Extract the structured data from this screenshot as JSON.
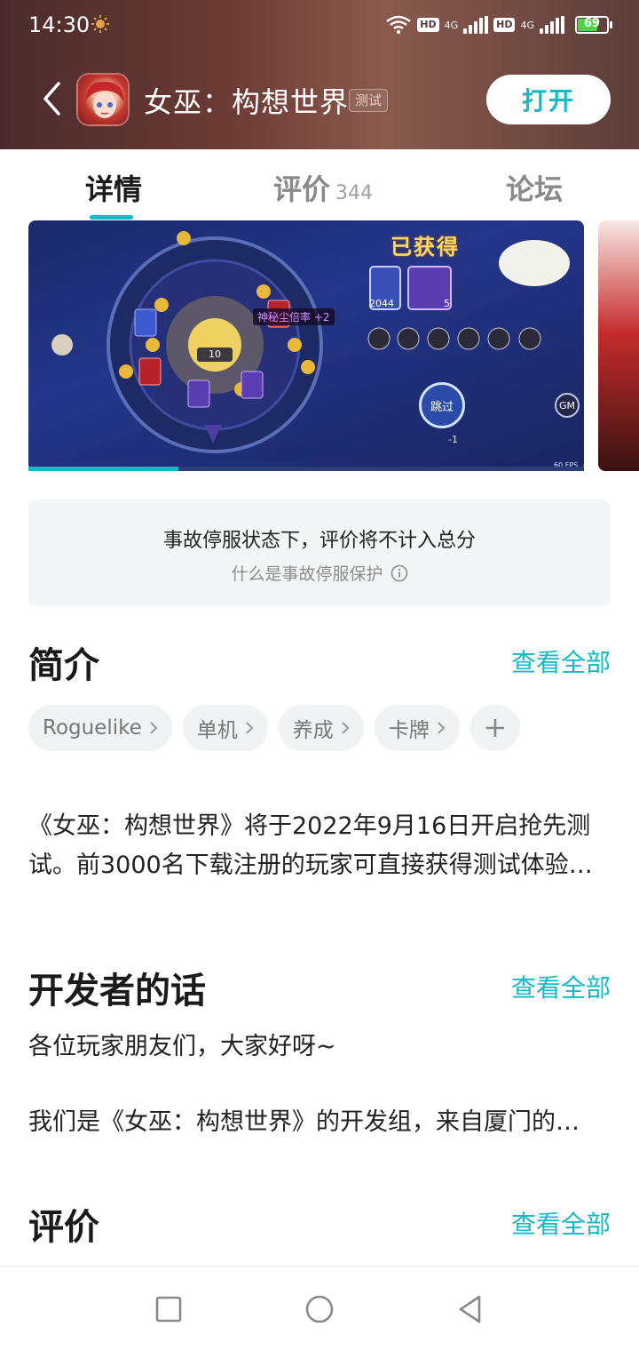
{
  "status_bar": {
    "time": "14:30",
    "battery": "69",
    "battery_level": 0.69,
    "network_1": "4G",
    "network_2": "4G",
    "hd": "HD"
  },
  "app_bar": {
    "title": "女巫：构想世界",
    "badge": "测试",
    "open_label": "打开"
  },
  "tabs": [
    {
      "label": "详情"
    },
    {
      "label": "评价",
      "count": "344"
    },
    {
      "label": "论坛"
    }
  ],
  "media": {
    "obtained": "已获得",
    "bonus": "神秘尘倍率 +2",
    "skip": "跳过",
    "skip_cost": "-1",
    "gm": "GM",
    "fps": "60 FPS",
    "dial_counter": "10",
    "stack_count": "2044",
    "item_count": "5",
    "progress": 0.27
  },
  "notice": {
    "title": "事故停服状态下，评价将不计入总分",
    "link": "什么是事故停服保护"
  },
  "intro": {
    "title": "简介",
    "view_all": "查看全部",
    "tags": [
      "Roguelike",
      "单机",
      "养成",
      "卡牌"
    ],
    "text": "《女巫：构想世界》将于2022年9月16日开启抢先测试。前3000名下载注册的玩家可直接获得测试体验…"
  },
  "developer": {
    "title": "开发者的话",
    "view_all": "查看全部",
    "line1": "各位玩家朋友们，大家好呀~",
    "line2": "我们是《女巫：构想世界》的开发组，来自厦门的…"
  },
  "reviews": {
    "title": "评价",
    "view_all": "查看全部"
  },
  "colors": {
    "accent": "#14b9c8",
    "header_bg": "#6b3a34"
  }
}
